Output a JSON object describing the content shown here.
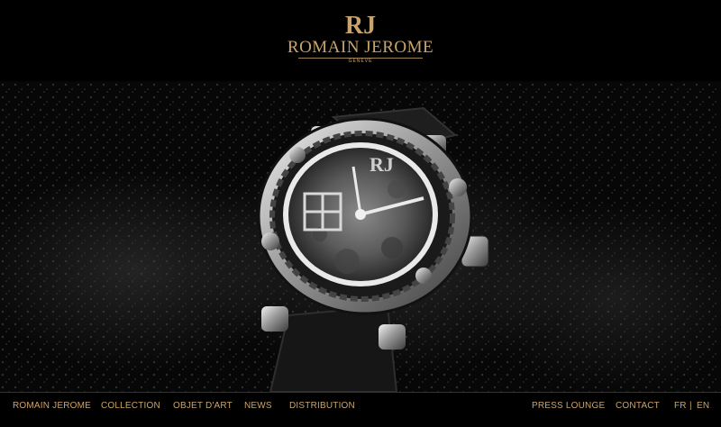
{
  "brand": {
    "name": "ROMAIN JEROME",
    "monogram": "RJ",
    "subline": "GENEVE",
    "color": "#c9a46a"
  },
  "hero": {
    "image_description_icon": "luxury-watch-image"
  },
  "nav_left": [
    {
      "label": "ROMAIN JEROME"
    },
    {
      "label": "COLLECTION"
    },
    {
      "label": "OBJET D'ART"
    },
    {
      "label": "NEWS"
    },
    {
      "label": "DISTRIBUTION"
    }
  ],
  "nav_right": [
    {
      "label": "PRESS LOUNGE"
    },
    {
      "label": "CONTACT"
    }
  ],
  "languages": {
    "fr": "FR",
    "separator": "|",
    "en": "EN"
  }
}
